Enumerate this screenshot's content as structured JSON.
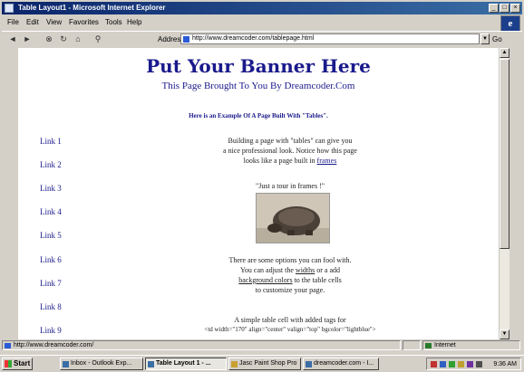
{
  "window": {
    "title": "Table Layout1 - Microsoft Internet Explorer",
    "caption_buttons": [
      "_",
      "□",
      "×"
    ]
  },
  "menu": {
    "items": [
      "File",
      "Edit",
      "View",
      "Favorites",
      "Tools",
      "Help"
    ]
  },
  "toolbar": {
    "buttons": [
      "back-icon",
      "forward-icon",
      "stop-icon",
      "refresh-icon",
      "home-icon",
      "search-icon"
    ],
    "address_label": "Address",
    "address_value": "http://www.dreamcoder.com/tablepage.html",
    "go_label": "Go",
    "dropdown_glyph": "▼"
  },
  "page": {
    "banner": "Put Your Banner Here",
    "subbanner": "This Page Brought To You By Dreamcoder.Com",
    "example_line": "Here is an Example Of A Page Built With \"Tables\".",
    "links": [
      "Link 1",
      "Link 2",
      "Link 3",
      "Link 4",
      "Link 5",
      "Link 6",
      "Link 7",
      "Link 8",
      "Link 9"
    ],
    "para1_line1": "Building a page with \"tables\" can give you",
    "para1_line2": "a nice professional look. Notice how this page",
    "para1_line3_prefix": "looks like a page built in ",
    "para1_line3_link": "frames",
    "caption": "\"Just a tour in frames !\"",
    "para2_line1": "There are some options you can fool with.",
    "para2_line2_prefix": "You can adjust the ",
    "para2_line2_link": "widths",
    "para2_line2_suffix": " or a add",
    "para2_line3_link": "background colors",
    "para2_line3_suffix": " to the table cells",
    "para2_line4": "to customize your page.",
    "para3_line1": "A simple table cell with added tags for",
    "para3_line2": "<td width=\"170\" align=\"center\" valign=\"top\" bgcolor=\"lightblue\">"
  },
  "scrollbar": {
    "up": "▲",
    "down": "▼"
  },
  "status": {
    "url": "http://www.dreamcoder.com/",
    "zone": "Internet"
  },
  "taskbar": {
    "start_label": "Start",
    "tasks": [
      {
        "label": "Inbox - Outlook Exp..."
      },
      {
        "label": "Table Layout 1 - ..."
      },
      {
        "label": "Jasc Paint Shop Pro"
      },
      {
        "label": "dreamcoder.com - I..."
      }
    ],
    "clock": "9:36 AM"
  },
  "colors": {
    "link_blue": "#1a1a8c",
    "titlebar_dark": "#0a246a",
    "chrome": "#d4d0c8"
  }
}
